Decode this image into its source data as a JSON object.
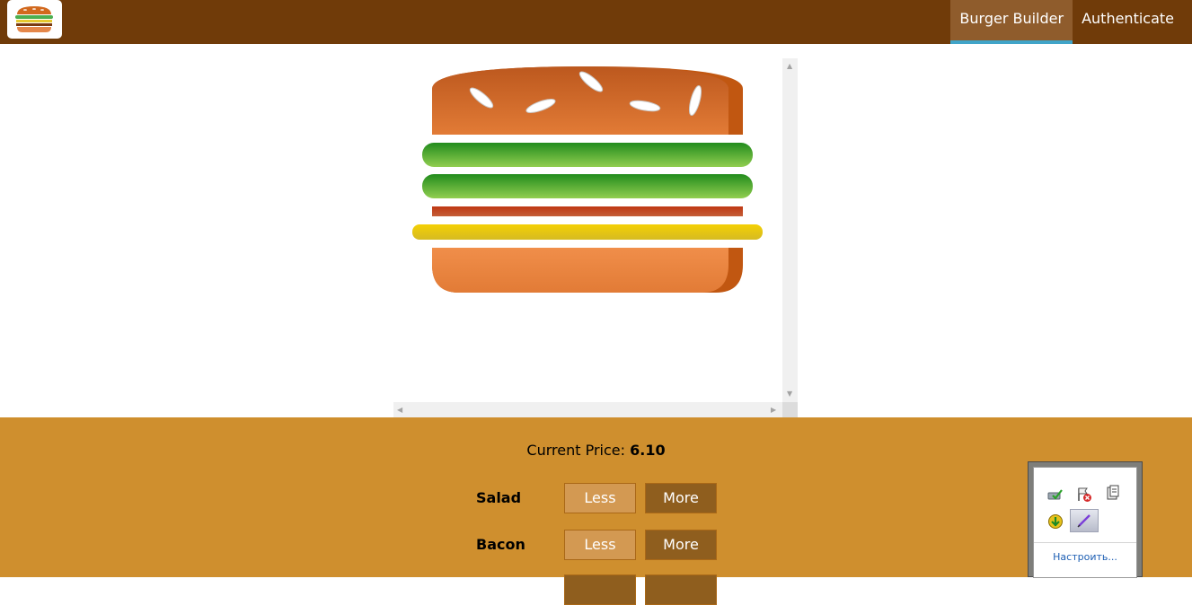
{
  "toolbar": {
    "logo_icon": "burger-logo-icon",
    "nav": [
      {
        "label": "Burger Builder",
        "active": true
      },
      {
        "label": "Authenticate",
        "active": false
      }
    ]
  },
  "burger": {
    "layers": [
      "bread-top",
      "salad",
      "salad",
      "bacon",
      "cheese",
      "bread-bottom"
    ]
  },
  "controls": {
    "price_label": "Current Price:",
    "price_value": "6.10",
    "rows": [
      {
        "label": "Salad",
        "less": "Less",
        "more": "More"
      },
      {
        "label": "Bacon",
        "less": "Less",
        "more": "More"
      }
    ]
  },
  "tray": {
    "icons": [
      "network-check-icon",
      "flag-error-icon",
      "clipboard-icon",
      "update-arrow-icon",
      "pen-icon"
    ],
    "customize_link": "Настроить..."
  },
  "colors": {
    "toolbar": "#703B09",
    "controls_bg": "#CF8F2E",
    "active_underline": "#40A4C8"
  }
}
